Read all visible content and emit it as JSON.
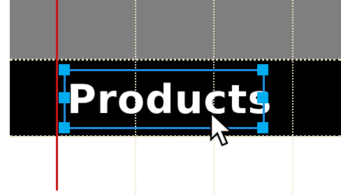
{
  "canvas": {
    "top_band_color": "#7f7f7f",
    "text_band_color": "#000000",
    "margin_line_color": "#c81414",
    "guide_color": "#ece3c6"
  },
  "text_object": {
    "label": "Products",
    "text_color": "#ffffff",
    "selected": true,
    "selection_color": "#1e90e6",
    "handle_color": "#00aef0",
    "handles": [
      "top-left",
      "top-right",
      "middle-left",
      "middle-right",
      "bottom-left",
      "bottom-right"
    ]
  },
  "pointer": {
    "icon": "arrow-cursor-icon"
  }
}
